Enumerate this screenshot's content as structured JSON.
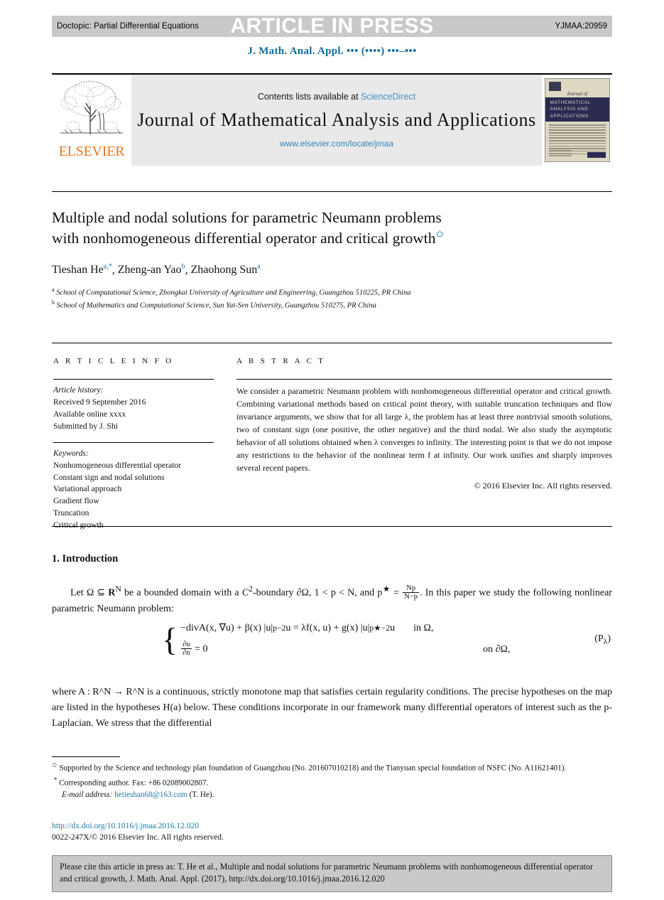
{
  "header": {
    "doctopic": "Doctopic: Partial Differential Equations",
    "article_in_press": "ARTICLE IN PRESS",
    "manuscript_code": "YJMAA:20959",
    "running_head": "J. Math. Anal. Appl. ••• (••••) •••–•••"
  },
  "masthead": {
    "contents_prefix": "Contents lists available at ",
    "sciencedirect": "ScienceDirect",
    "journal_title": "Journal of Mathematical Analysis and Applications",
    "journal_url": "www.elsevier.com/locate/jmaa",
    "publisher_word": "ELSEVIER",
    "cover": {
      "journal_of": "Journal of",
      "band_line1": "MATHEMATICAL",
      "band_line2": "ANALYSIS AND",
      "band_line3": "APPLICATIONS"
    }
  },
  "article": {
    "title_line1": "Multiple and nodal solutions for parametric Neumann problems",
    "title_line2": "with nonhomogeneous differential operator and critical growth",
    "title_star": "✩",
    "authors": [
      {
        "name": "Tieshan He",
        "marks": "a,*"
      },
      {
        "name": "Zheng-an Yao",
        "marks": "b"
      },
      {
        "name": "Zhaohong Sun",
        "marks": "a"
      }
    ],
    "affiliations": [
      {
        "mark": "a",
        "text": "School of Computational Science, Zhongkai University of Agriculture and Engineering, Guangzhou 510225, PR China"
      },
      {
        "mark": "b",
        "text": "School of Mathematics and Computational Science, Sun Yat-Sen University, Guangzhou 510275, PR China"
      }
    ]
  },
  "info": {
    "label": "A R T I C L E   I N F O",
    "history_label": "Article history:",
    "history": [
      "Received 9 September 2016",
      "Available online xxxx",
      "Submitted by J. Shi"
    ],
    "keywords_label": "Keywords:",
    "keywords": [
      "Nonhomogeneous differential operator",
      "Constant sign and nodal solutions",
      "Variational approach",
      "Gradient flow",
      "Truncation",
      "Critical growth"
    ]
  },
  "abstract": {
    "label": "A B S T R A C T",
    "text": "We consider a parametric Neumann problem with nonhomogeneous differential operator and critical growth. Combining variational methods based on critical point theory, with suitable truncation techniques and flow invariance arguments, we show that for all large λ, the problem has at least three nontrivial smooth solutions, two of constant sign (one positive, the other negative) and the third nodal. We also study the asymptotic behavior of all solutions obtained when λ converges to infinity. The interesting point is that we do not impose any restrictions to the behavior of the nonlinear term f at infinity. Our work unifies and sharply improves several recent papers.",
    "copyright": "© 2016 Elsevier Inc. All rights reserved."
  },
  "body": {
    "section_heading": "1.  Introduction",
    "paragraph1_a": "Let Ω ⊆ ",
    "paragraph1_b": " be a bounded domain with a ",
    "paragraph1_c": "-boundary ∂Ω, 1 < p < N, and p",
    "paragraph1_d": " = ",
    "paragraph1_e": ". In this paper we study the following nonlinear parametric Neumann problem:",
    "rn": "R",
    "rn_sup": "N",
    "c2": "C",
    "c2_sup": "2",
    "pstar_sup": "★",
    "frac_num": "Np",
    "frac_den": "N−p",
    "equation": {
      "line1_lhs": "−divA(x, ∇u) + β(x) |u|",
      "line1_sup1": "p−2",
      "line1_mid": " u = λf(x, u) + g(x) |u|",
      "line1_sup2": "p★−2",
      "line1_tail": " u",
      "line1_cond": "in Ω,",
      "line2_frac_num": "∂u",
      "line2_frac_den": "∂n",
      "line2_rhs": " = 0",
      "line2_cond": "on ∂Ω,",
      "label": "(P",
      "label_sub": "λ",
      "label_close": ")"
    },
    "paragraph2": "where A : R^N → R^N is a continuous, strictly monotone map that satisfies certain regularity conditions. The precise hypotheses on the map are listed in the hypotheses H(a) below. These conditions incorporate in our framework many differential operators of interest such as the p-Laplacian. We stress that the differential"
  },
  "footnotes": {
    "funding_mark": "✩",
    "funding": "Supported by the Science and technology plan foundation of Guangzhou (No. 201607010218) and the Tianyuan special foundation of NSFC (No. A11621401).",
    "corresponding_mark": "*",
    "corresponding": "Corresponding author. Fax: +86 02089002807.",
    "email_label": "E-mail address:",
    "email": "hetieshan68@163.com",
    "email_suffix": "(T. He).",
    "doi": "http://dx.doi.org/10.1016/j.jmaa.2016.12.020",
    "issn": "0022-247X/© 2016 Elsevier Inc. All rights reserved."
  },
  "cite_box": {
    "text": "Please cite this article in press as: T. He et al., Multiple and nodal solutions for parametric Neumann problems with nonhomogeneous differential operator and critical growth, J. Math. Anal. Appl. (2017), http://dx.doi.org/10.1016/j.jmaa.2016.12.020"
  },
  "colors": {
    "accent_blue": "#0d6e9e",
    "link_blue": "#1a7aa8",
    "sciencedirect_blue": "#3f94c6",
    "elsevier_orange": "#e87722",
    "bar_gray": "#c9c9c9",
    "masthead_gray": "#e9e9e9",
    "cover_navy": "#2b2b52",
    "cover_beige": "#ded8c3"
  }
}
